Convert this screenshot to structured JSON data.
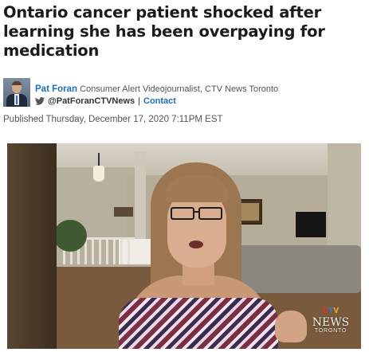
{
  "article": {
    "headline": "Ontario cancer patient shocked after learning she has been overpaying for medication",
    "author": {
      "name": "Pat Foran",
      "title": "Consumer Alert Videojournalist, CTV News Toronto",
      "twitter_handle": "@PatForanCTVNews",
      "separator": "|",
      "contact_label": "Contact"
    },
    "published": "Published Thursday, December 17, 2020 7:11PM EST"
  },
  "video": {
    "watermark": {
      "logo_c": "C",
      "logo_t": "T",
      "logo_v": "V",
      "brand": "NEWS",
      "city": "TORONTO"
    }
  },
  "colors": {
    "link": "#1f6fbf",
    "headline": "#1b1b1b",
    "meta_text": "#555555",
    "twitter_icon": "#555555"
  },
  "icons": {
    "twitter": "twitter-bird-icon"
  }
}
